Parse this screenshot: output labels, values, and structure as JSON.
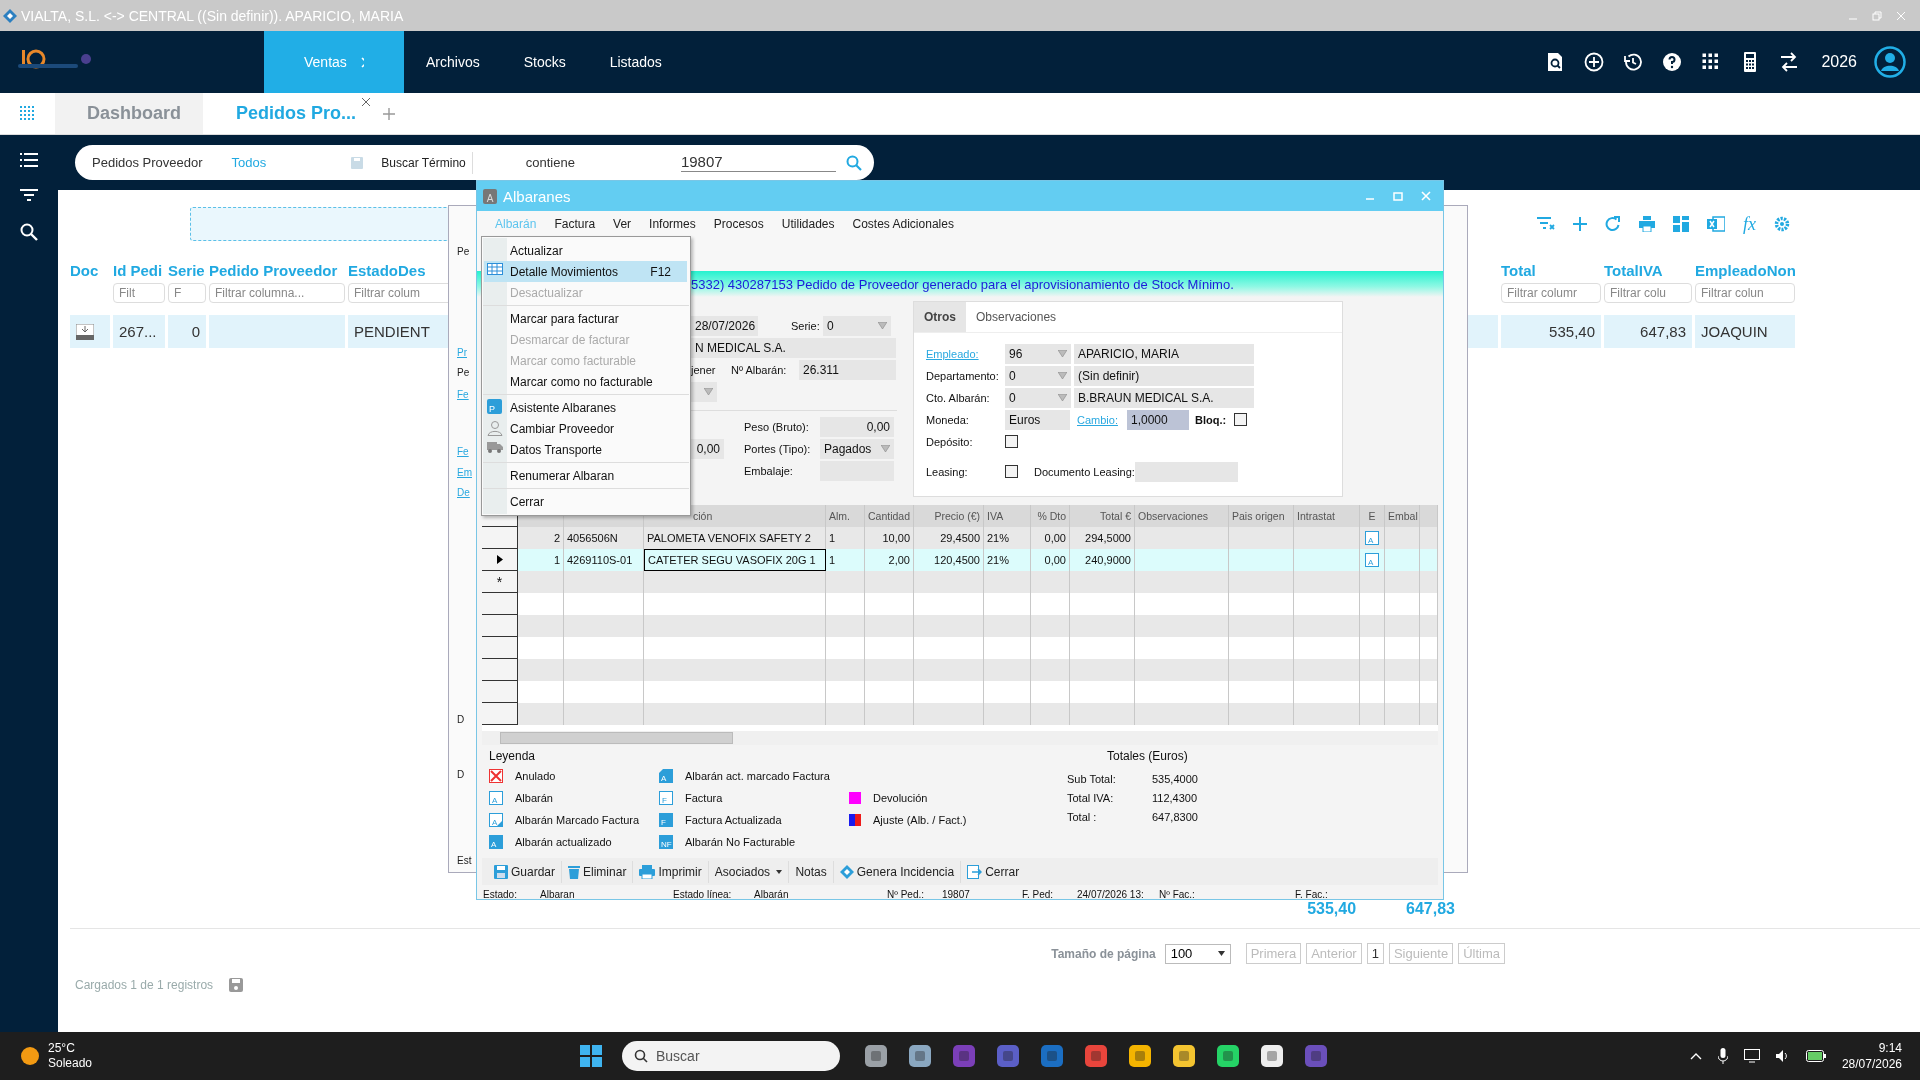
{
  "window": {
    "title": "VIALTA, S.L. <-> CENTRAL ((Sin definir)). APARICIO, MARIA"
  },
  "nav": {
    "items": [
      {
        "label": "Ventas",
        "selected": true
      },
      {
        "label": "Archivos",
        "selected": false
      },
      {
        "label": "Stocks",
        "selected": false
      },
      {
        "label": "Listados",
        "selected": false
      }
    ],
    "year": "2026"
  },
  "tabs": [
    {
      "label": "Dashboard",
      "selected": false,
      "closable": false
    },
    {
      "label": "Pedidos Pro...",
      "selected": true,
      "closable": true
    }
  ],
  "search": {
    "list": "Pedidos Proveedor",
    "filter": "Todos",
    "field_label": "Buscar Término",
    "operator": "contiene",
    "value": "19807"
  },
  "toolbar": {
    "formula": "fx"
  },
  "table": {
    "columns": [
      {
        "header": "Doc"
      },
      {
        "header": "Id Pedi",
        "filter": "Filt"
      },
      {
        "header": "Serie",
        "filter": "F"
      },
      {
        "header": "Pedido Proveedor",
        "filter": "Filtrar columna..."
      },
      {
        "header": "EstadoDes",
        "filter": "Filtrar colum"
      },
      {
        "header": "Total",
        "filter": "Filtrar columr"
      },
      {
        "header": "TotalIVA",
        "filter": "Filtrar colu"
      },
      {
        "header": "EmpleadoNon",
        "filter": "Filtrar colun"
      }
    ],
    "rows": [
      {
        "selected": true,
        "id": "267...",
        "serie": "0",
        "estado": "PENDIENT",
        "total": "535,40",
        "total_iva": "647,83",
        "empleado": "JOAQUIN"
      }
    ]
  },
  "footer": {
    "totals": [
      "535,40",
      "647,83"
    ],
    "page_size_label": "Tamaño de página",
    "page_size": "100",
    "pager": [
      {
        "label": "Primera",
        "disabled": true
      },
      {
        "label": "Anterior",
        "disabled": true
      },
      {
        "label": "1",
        "disabled": false
      },
      {
        "label": "Siguiente",
        "disabled": true
      },
      {
        "label": "Última",
        "disabled": true
      }
    ],
    "loaded": "Cargados 1 de 1 registros"
  },
  "behind_window": {
    "fragments": [
      {
        "text": "Pe",
        "kind": "plain"
      },
      {
        "text": "Pr",
        "kind": "link"
      },
      {
        "text": "Pe",
        "kind": "plain"
      },
      {
        "text": "Fe",
        "kind": "link"
      },
      {
        "text": "Fe",
        "kind": "link"
      },
      {
        "text": "Em",
        "kind": "link"
      },
      {
        "text": "De",
        "kind": "link"
      },
      {
        "text": "D",
        "kind": "plain"
      },
      {
        "text": "D",
        "kind": "plain"
      },
      {
        "text": "Est",
        "kind": "plain"
      }
    ]
  },
  "dialog": {
    "title": "Albaranes",
    "icon_letter": "A",
    "menu": [
      {
        "label": "Albarán",
        "selected": true
      },
      {
        "label": "Factura",
        "selected": false
      },
      {
        "label": "Ver",
        "selected": false
      },
      {
        "label": "Informes",
        "selected": false
      },
      {
        "label": "Procesos",
        "selected": false
      },
      {
        "label": "Utilidades",
        "selected": false
      },
      {
        "label": "Costes Adicionales",
        "selected": false
      }
    ],
    "dropdown": [
      {
        "items": [
          {
            "label": "Actualizar",
            "disabled": false,
            "highlighted": false
          },
          {
            "label": "Detalle Movimientos",
            "shortcut": "F12",
            "kind": "grid",
            "disabled": false,
            "highlighted": true
          },
          {
            "label": "Desactualizar",
            "disabled": true,
            "highlighted": false
          }
        ]
      },
      {
        "items": [
          {
            "label": "Marcar para facturar",
            "disabled": false,
            "highlighted": false
          },
          {
            "label": "Desmarcar de facturar",
            "disabled": true,
            "highlighted": false
          },
          {
            "label": "Marcar como facturable",
            "disabled": true,
            "highlighted": false
          },
          {
            "label": "Marcar como no facturable",
            "disabled": false,
            "highlighted": false
          }
        ]
      },
      {
        "items": [
          {
            "label": "Asistente Albaranes",
            "kind": "badge",
            "badge": "P",
            "disabled": false,
            "highlighted": false
          },
          {
            "label": "Cambiar Proveedor",
            "kind": "person",
            "disabled": false,
            "highlighted": false
          },
          {
            "label": "Datos Transporte",
            "kind": "truck",
            "disabled": false,
            "highlighted": false
          }
        ]
      },
      {
        "items": [
          {
            "label": "Renumerar Albaran",
            "disabled": false,
            "highlighted": false
          }
        ]
      },
      {
        "items": [
          {
            "label": "Cerrar",
            "disabled": false,
            "highlighted": false
          }
        ]
      }
    ],
    "banner": "5332) 430287153 Pedido de Proveedor generado para el aprovisionamiento de Stock Mínimo.",
    "form": {
      "date": "28/07/2026",
      "serie_label": "Serie:",
      "serie": "0",
      "supplier": "N MEDICAL S.A.",
      "cut_label": "jener",
      "albaran_label": "Nº Albarán:",
      "albaran": "26.311",
      "amount": "0,00",
      "peso_label": "Peso (Bruto):",
      "peso": "0,00",
      "portes_label": "Portes (Tipo):",
      "portes": "Pagados",
      "embalaje_label": "Embalaje:"
    },
    "tabs": [
      {
        "label": "Otros",
        "selected": true
      },
      {
        "label": "Observaciones",
        "selected": false
      }
    ],
    "otros": {
      "rows": [
        {
          "label": "Empleado:",
          "link": true,
          "code": "96",
          "name": "APARICIO, MARIA"
        },
        {
          "label": "Departamento:",
          "link": false,
          "code": "0",
          "name": "(Sin definir)"
        },
        {
          "label": "Cto. Albarán:",
          "link": false,
          "code": "0",
          "name": "B.BRAUN MEDICAL S.A."
        }
      ],
      "moneda_label": "Moneda:",
      "moneda": "Euros",
      "cambio_label": "Cambio:",
      "cambio": "1,0000",
      "bloq_label": "Bloq.:",
      "bloq": false,
      "deposito_label": "Depósito:",
      "deposito": false,
      "leasing_label": "Leasing:",
      "leasing": false,
      "doc_leasing_label": "Documento Leasing:"
    },
    "grid": {
      "headers": [
        "ción",
        "Alm.",
        "Cantidad",
        "Precio (€)",
        "IVA",
        "% Dto",
        "Total €",
        "Observaciones",
        "Pais origen",
        "Intrastat",
        "E",
        "Embal"
      ],
      "new_row_marker": "*",
      "rows": [
        {
          "line": "2",
          "code": "4056506N",
          "desc": "PALOMETA VENOFIX SAFETY 2",
          "alm": "1",
          "cantidad": "10,00",
          "precio": "29,4500",
          "iva": "21%",
          "dto": "0,00",
          "total": "294,5000",
          "e_badge": "A",
          "selected": false
        },
        {
          "line": "1",
          "code": "4269110S-01",
          "desc": "CATETER SEGU VASOFIX 20G 1",
          "alm": "1",
          "cantidad": "2,00",
          "precio": "120,4500",
          "iva": "21%",
          "dto": "0,00",
          "total": "240,9000",
          "e_badge": "A",
          "selected": true
        }
      ]
    },
    "legend": {
      "title": "Leyenda",
      "columns": [
        [
          {
            "label": "Anulado",
            "kind": "cross"
          },
          {
            "label": "Albarán",
            "kind": "outline",
            "glyph": "A"
          },
          {
            "label": "Albarán Marcado Factura",
            "kind": "outline-marked",
            "glyph": "A"
          },
          {
            "label": "Albarán actualizado",
            "kind": "filled",
            "glyph": "A"
          }
        ],
        [
          {
            "label": "Albarán act. marcado Factura",
            "kind": "filled-marked",
            "glyph": "A"
          },
          {
            "label": "Factura",
            "kind": "outline",
            "glyph": "F"
          },
          {
            "label": "Factura Actualizada",
            "kind": "filled",
            "glyph": "F"
          },
          {
            "label": "Albarán No Facturable",
            "kind": "filled",
            "glyph": "NF"
          }
        ],
        [
          {
            "label": "Devolución",
            "kind": "swatch",
            "color": "#ff00ff"
          },
          {
            "label": "Ajuste  (Alb. / Fact.)",
            "kind": "split"
          }
        ]
      ]
    },
    "totals": {
      "title": "Totales (Euros)",
      "rows": [
        {
          "label": "Sub Total:",
          "value": "535,4000"
        },
        {
          "label": "Total IVA:",
          "value": "112,4300"
        },
        {
          "label": "Total :",
          "value": "647,8300"
        }
      ]
    },
    "buttons": [
      {
        "label": "Guardar",
        "kind": "save"
      },
      {
        "label": "Eliminar",
        "kind": "trash"
      },
      {
        "label": "Imprimir",
        "kind": "print"
      },
      {
        "label": "Asociados",
        "kind": "menu"
      },
      {
        "label": "Notas",
        "kind": "plain"
      },
      {
        "label": "Genera Incidencia",
        "kind": "incident"
      },
      {
        "label": "Cerrar",
        "kind": "exit"
      }
    ],
    "status": [
      {
        "label": "Estado:",
        "value": "Albaran"
      },
      {
        "label": "Estado línea:",
        "value": "Albarán"
      },
      {
        "label": "Nº Ped.:",
        "value": "19807"
      },
      {
        "label": "F. Ped:",
        "value": "24/07/2026 13:"
      },
      {
        "label": "Nº Fac.:"
      },
      {
        "label": "F. Fac.:"
      }
    ]
  },
  "taskbar": {
    "temperature": "25°C",
    "weather": "Soleado",
    "search_placeholder": "Buscar",
    "time": "9:14",
    "date": "28/07/2026"
  }
}
